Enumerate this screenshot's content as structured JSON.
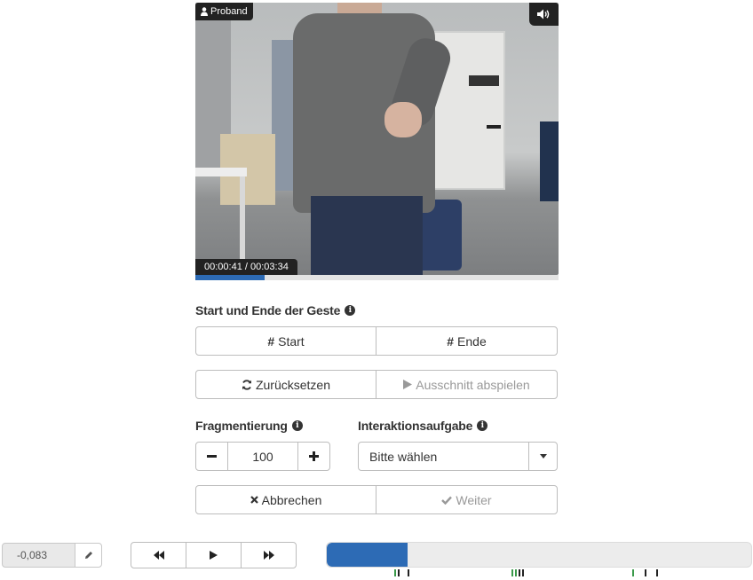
{
  "video": {
    "proband_label": "Proband",
    "sound_icon": "volume-icon",
    "time": "00:00:41 / 00:03:34",
    "progress": 0.19
  },
  "gesture": {
    "heading": "Start und Ende der Geste",
    "start_label": "Start",
    "end_label": "Ende",
    "reset_label": "Zurücksetzen",
    "play_label": "Ausschnitt abspielen"
  },
  "fragmentation": {
    "heading": "Fragmentierung",
    "value": "100"
  },
  "task": {
    "heading": "Interaktionsaufgabe",
    "selected": "Bitte wählen"
  },
  "actions": {
    "cancel_label": "Abbrechen",
    "next_label": "Weiter"
  },
  "footer": {
    "offset_value": "-0,083",
    "timeline_progress": 0.19
  },
  "colors": {
    "accent": "#2d6bb5",
    "dark": "#222222",
    "marker_green": "#3a9a4a"
  }
}
